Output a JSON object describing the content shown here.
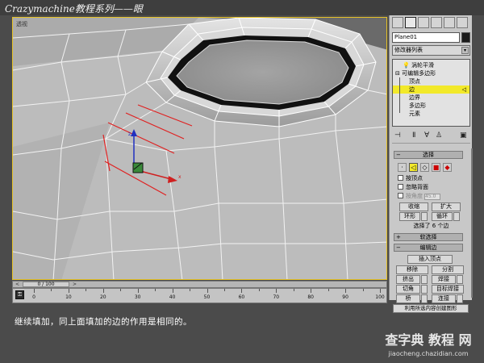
{
  "banner": {
    "title": "Crazymachine教程系列——眼"
  },
  "viewport": {
    "label": "透视",
    "edge_highlight_color": "#e02020",
    "border_color": "#e6c227"
  },
  "command_panel": {
    "object_name": "Plane01",
    "modifier_list": "修改器列表",
    "stack": {
      "items": [
        {
          "label": "涡轮平滑",
          "selected": false
        },
        {
          "label": "可编辑多边形",
          "selected": false
        },
        {
          "label": "顶点",
          "selected": false
        },
        {
          "label": "边",
          "selected": true
        },
        {
          "label": "边界",
          "selected": false
        },
        {
          "label": "多边形",
          "selected": false
        },
        {
          "label": "元素",
          "selected": false
        }
      ]
    },
    "selection_rollout": {
      "title": "选择",
      "by_vertex": "按顶点",
      "ignore_backfacing": "忽略背面",
      "by_angle": "按角度",
      "angle_value": "45.0",
      "shrink": "收缩",
      "grow": "扩大",
      "ring": "环形",
      "loop": "循环",
      "status": "选择了 6 个边"
    },
    "soft_selection_title": "软选择",
    "edit_edges_rollout": {
      "title": "编辑边",
      "insert_vertex": "插入顶点",
      "remove": "移除",
      "split": "分割",
      "extrude": "挤出",
      "weld": "焊接",
      "chamfer": "切角",
      "target_weld": "目标焊接",
      "bridge": "桥",
      "connect": "连接",
      "create_shape": "利用所选内容创建图形"
    }
  },
  "timeline": {
    "slider_label": "0 / 100",
    "ruler_labels": [
      "0",
      "10",
      "20",
      "30",
      "40",
      "50",
      "60",
      "70",
      "80",
      "90",
      "100"
    ]
  },
  "caption": "继续填加，同上面填加的边的作用是相同的。",
  "watermark": {
    "big": "查字典 教程 网",
    "small": "jiaocheng.chazidian.com"
  }
}
